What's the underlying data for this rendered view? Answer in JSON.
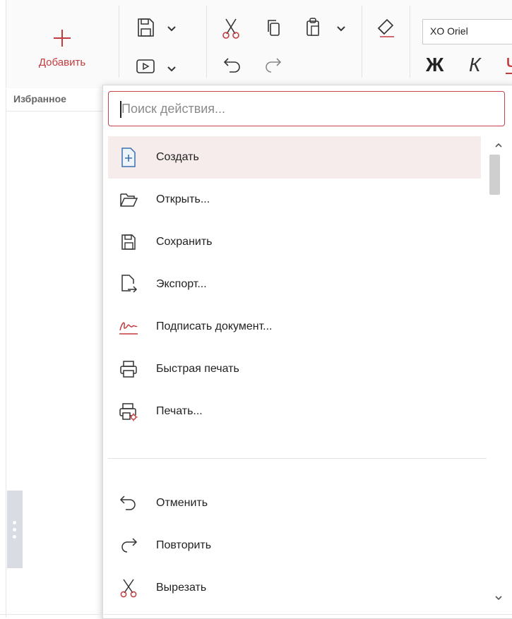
{
  "ribbon": {
    "add_label": "Добавить",
    "font_name": "XO Oriel",
    "bold_glyph": "Ж",
    "italic_glyph": "К",
    "underline_glyph": "Ч"
  },
  "sidebar": {
    "favorites_label": "Избранное"
  },
  "search": {
    "placeholder": "Поиск действия...",
    "value": ""
  },
  "menu": {
    "items": [
      {
        "label": "Создать",
        "icon": "new-document-icon",
        "active": true
      },
      {
        "label": "Открыть...",
        "icon": "folder-open-icon"
      },
      {
        "label": "Сохранить",
        "icon": "save-icon"
      },
      {
        "label": "Экспорт...",
        "icon": "export-icon"
      },
      {
        "label": "Подписать документ...",
        "icon": "signature-icon"
      },
      {
        "label": "Быстрая печать",
        "icon": "printer-icon"
      },
      {
        "label": "Печать...",
        "icon": "print-settings-icon"
      },
      {
        "label": "Отменить",
        "icon": "undo-icon"
      },
      {
        "label": "Повторить",
        "icon": "redo-icon"
      },
      {
        "label": "Вырезать",
        "icon": "cut-icon"
      }
    ]
  },
  "colors": {
    "accent": "#c33b3f",
    "active_bg": "#f7ecec"
  }
}
